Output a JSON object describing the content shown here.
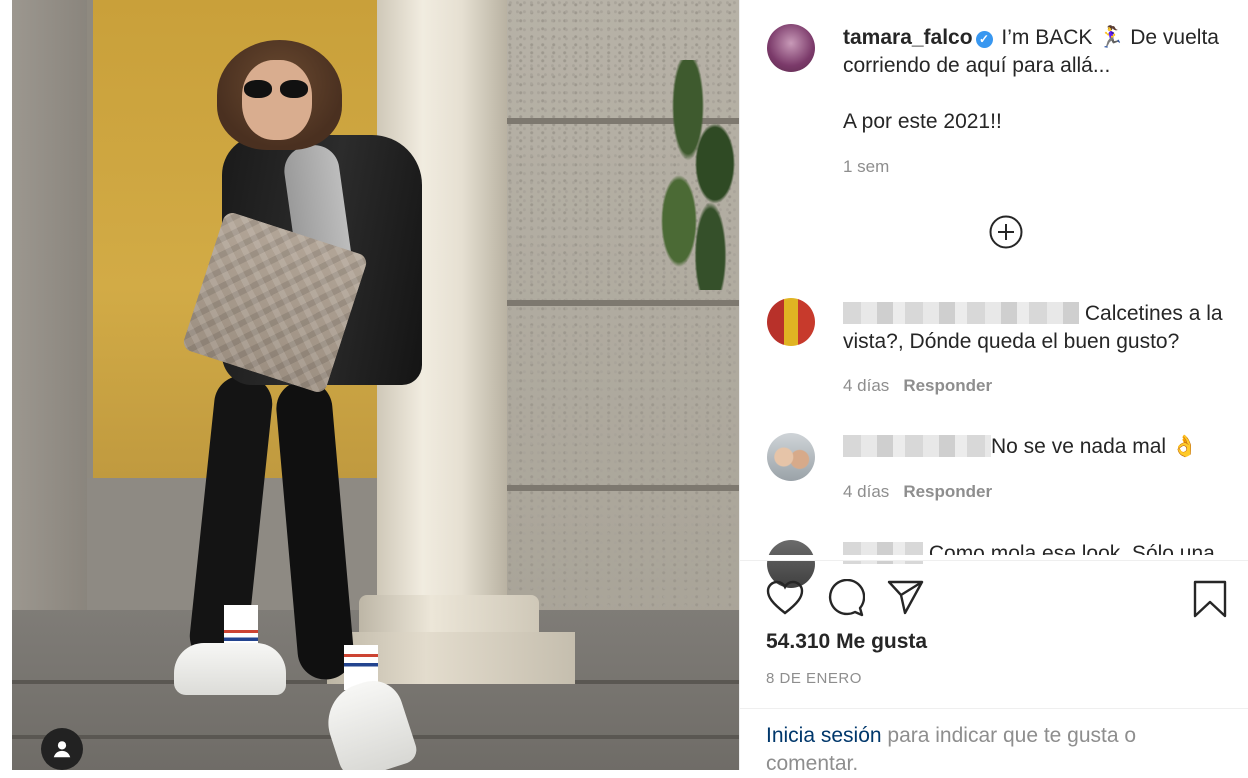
{
  "post": {
    "username": "tamara_falco",
    "caption_line1": " I’m BACK 🏃‍♀️ De vuelta corriendo de aquí para allá...",
    "caption_line2": "A por este 2021!!",
    "time": "1 sem",
    "likes": "54.310 Me gusta",
    "date": "8 DE ENERO"
  },
  "comments": [
    {
      "text": "Calcetines a la vista?, Dónde queda el buen gusto?",
      "time": "4 días",
      "reply": "Responder"
    },
    {
      "text": "No se ve nada mal 👌",
      "time": "4 días",
      "reply": "Responder"
    },
    {
      "text": "Como mola ese look. Sólo una"
    }
  ],
  "login": {
    "link": "Inicia sesión",
    "text": " para indicar que te gusta o comentar."
  },
  "icons": [
    "user-icon",
    "verified-icon",
    "load-more-icon",
    "heart-icon",
    "comment-icon",
    "share-icon",
    "bookmark-icon"
  ],
  "colors": {
    "verified": "#3897f0",
    "link": "#00376b",
    "muted": "#8e8e8e"
  }
}
